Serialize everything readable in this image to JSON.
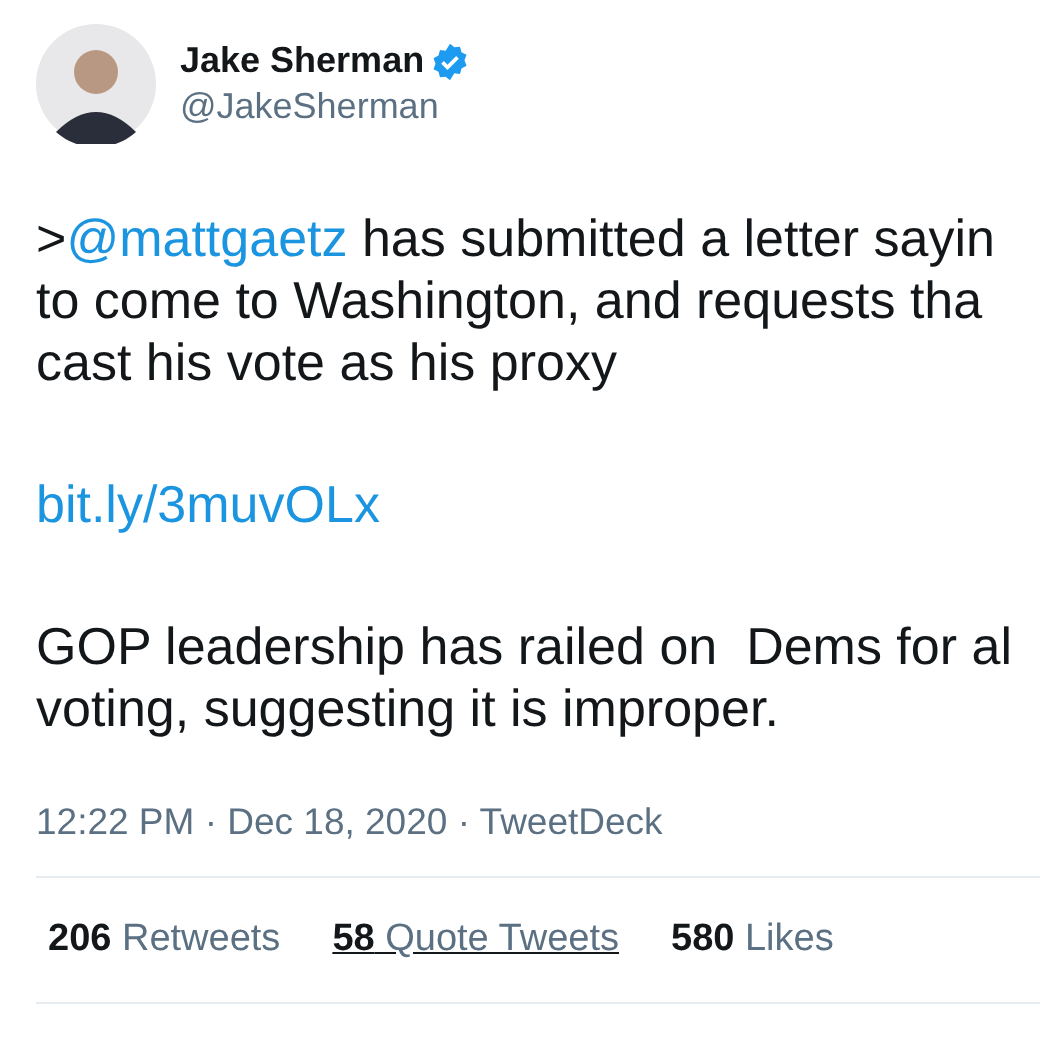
{
  "author": {
    "name": "Jake Sherman",
    "handle": "@JakeSherman",
    "verified": true
  },
  "paragraphs": [
    {
      "lines": [
        [
          {
            "kind": "text",
            "text": ">"
          },
          {
            "kind": "mention",
            "text": "@mattgaetz"
          },
          {
            "kind": "text",
            "text": " has submitted a letter sayin"
          }
        ],
        [
          {
            "kind": "text",
            "text": "to come to Washington, and requests tha"
          }
        ],
        [
          {
            "kind": "text",
            "text": "cast his vote as his proxy"
          }
        ]
      ]
    },
    {
      "lines": [
        [
          {
            "kind": "link",
            "text": "bit.ly/3muvOLx"
          }
        ]
      ]
    },
    {
      "lines": [
        [
          {
            "kind": "text",
            "text": "GOP leadership has railed on  Dems for al"
          }
        ],
        [
          {
            "kind": "text",
            "text": "voting, suggesting it is improper."
          }
        ]
      ]
    }
  ],
  "meta": "12:22 PM · Dec 18, 2020 · TweetDeck",
  "stats": [
    {
      "count": "206",
      "label": "Retweets",
      "underlined": false
    },
    {
      "count": "58",
      "label": "Quote Tweets",
      "underlined": true
    },
    {
      "count": "580",
      "label": "Likes",
      "underlined": false
    }
  ]
}
